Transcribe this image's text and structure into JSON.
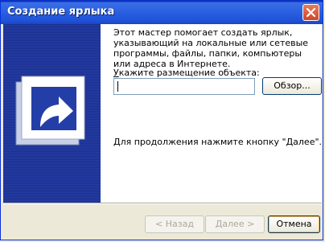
{
  "window": {
    "title": "Создание ярлыка"
  },
  "content": {
    "intro": "Этот мастер помогает создать ярлык, указывающий на локальные или сетевые программы, файлы, папки, компьютеры или адреса в Интернете.",
    "location_label_prefix": "",
    "location_label_underlined": "У",
    "location_label_rest": "кажите размещение объекта:",
    "location_value": "",
    "browse_label": "Обзор...",
    "finish_text": "Для продолжения нажмите кнопку \"Далее\"."
  },
  "buttons": {
    "back": "< Назад",
    "next": "Далее >",
    "cancel": "Отмена"
  },
  "icons": {
    "close": "close-icon",
    "wizard": "shortcut-arrow-icon"
  },
  "colors": {
    "title_bar": "#2a5fe0",
    "panel": "#243ea8",
    "close": "#d2432a"
  }
}
